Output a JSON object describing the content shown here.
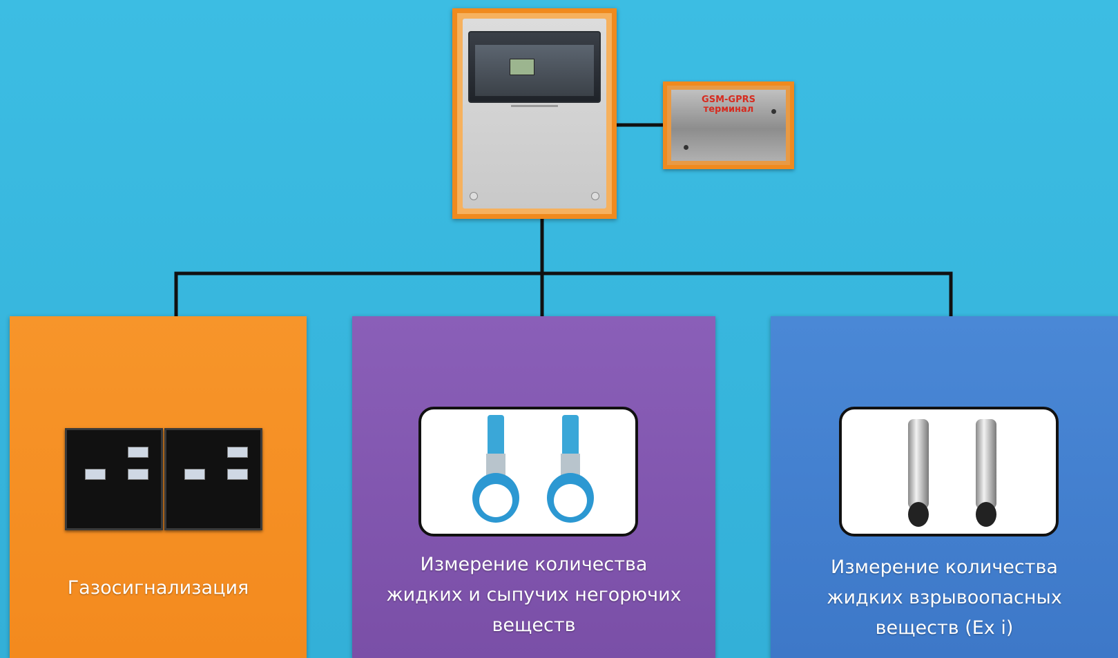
{
  "gsm_terminal": {
    "line1": "GSM-GPRS",
    "line2": "терминал"
  },
  "categories": [
    {
      "caption": "Газосигнализация",
      "device": "gas-sensor"
    },
    {
      "caption_lines": [
        "Измерение  количества",
        "жидких и сыпучих негорючих",
        "веществ"
      ],
      "device": "ultrasonic-level-sensor"
    },
    {
      "caption_lines": [
        "Измерение  количества",
        "жидких взрывоопасных",
        "веществ (Ex i)"
      ],
      "device": "hydrostatic-level-probe"
    }
  ],
  "colors": {
    "background": "#38b8df",
    "gas_panel": "#f5901f",
    "liquid_panel": "#7f55ad",
    "ex_panel": "#4282cf",
    "frame_border": "#f08a1e",
    "wire": "#111111"
  }
}
